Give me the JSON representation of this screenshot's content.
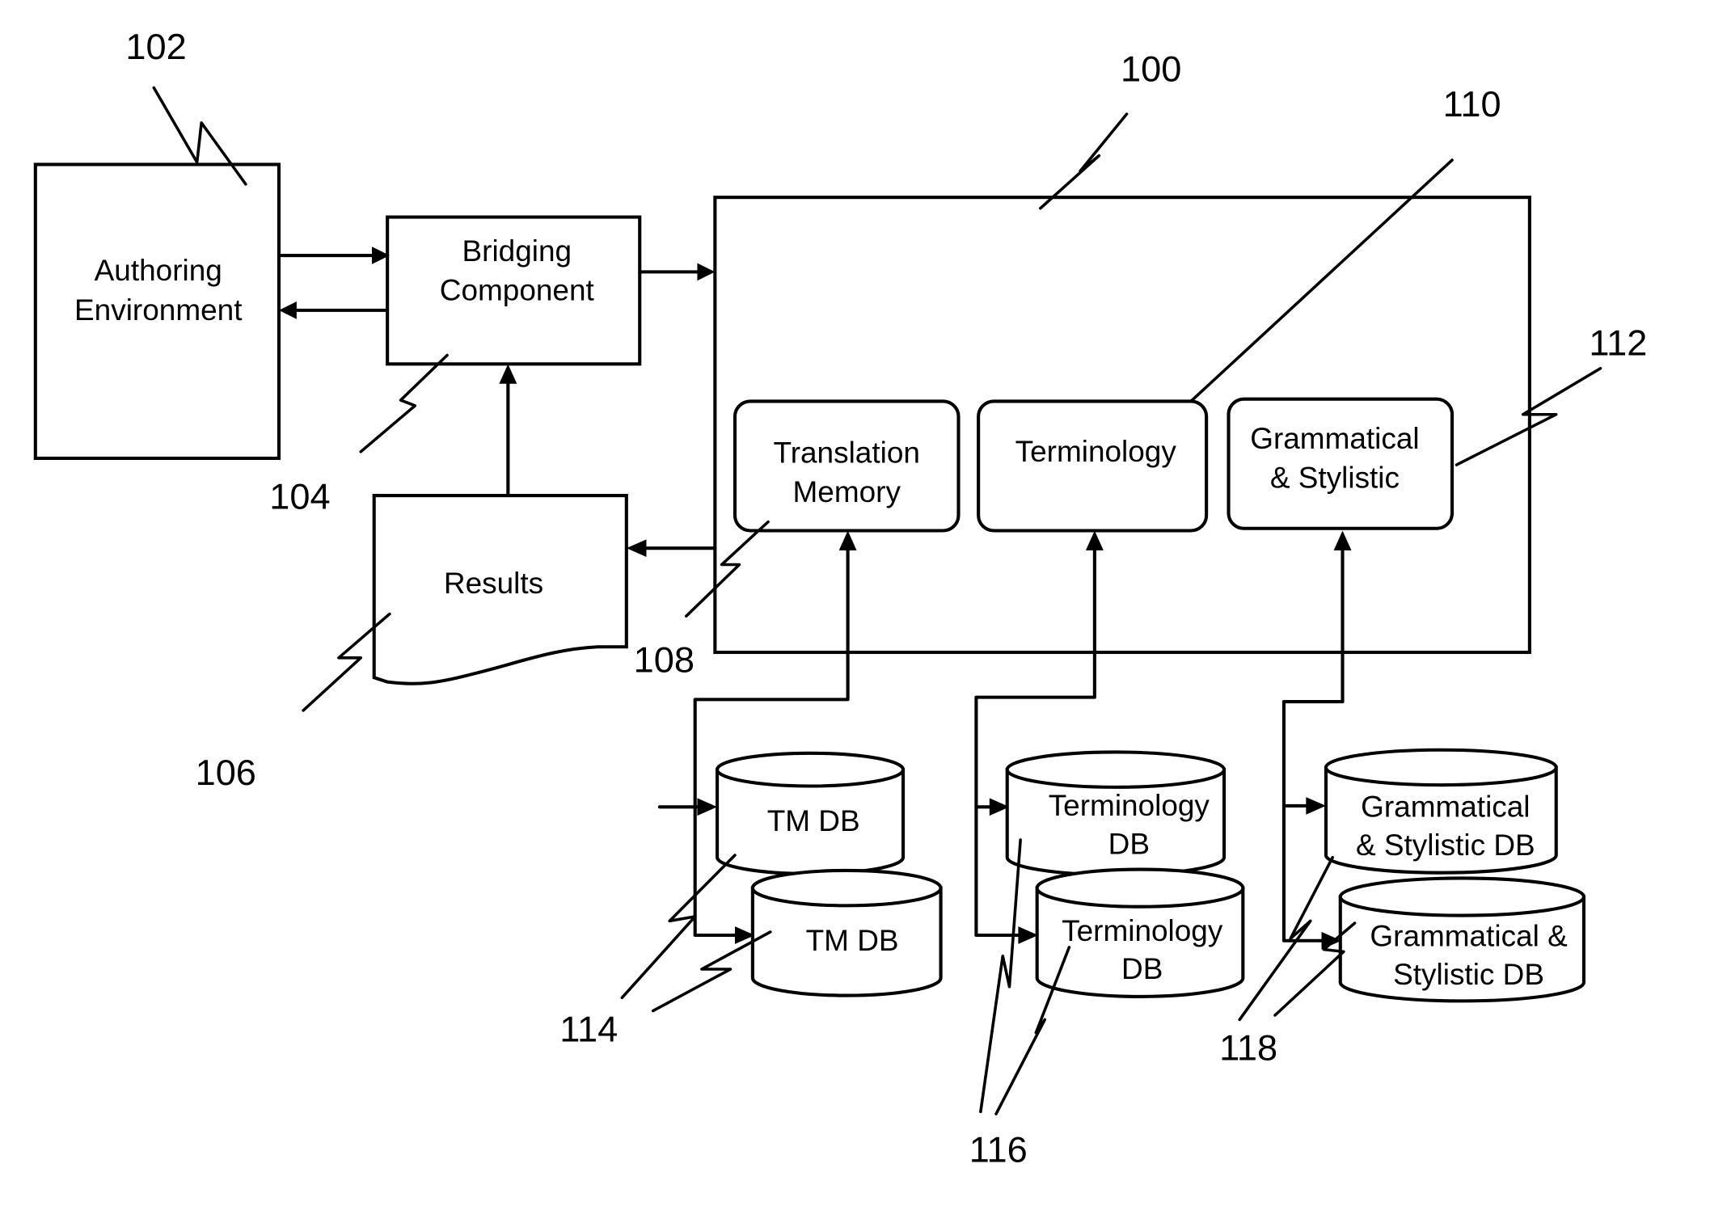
{
  "diagram": {
    "type": "block-diagram",
    "nodes": {
      "authoring": {
        "ref": "102",
        "lines": [
          "Authoring",
          "Environment"
        ]
      },
      "bridging": {
        "ref": "104",
        "lines": [
          "Bridging",
          "Component"
        ]
      },
      "results": {
        "ref": "106",
        "lines": [
          "Results"
        ]
      },
      "system": {
        "ref": "100"
      },
      "translation_memory": {
        "ref": "108",
        "lines": [
          "Translation",
          "Memory"
        ]
      },
      "terminology": {
        "ref": "110",
        "lines": [
          "Terminology"
        ]
      },
      "grammatical": {
        "ref": "112",
        "lines": [
          "Grammatical",
          "& Stylistic"
        ]
      },
      "tm_db_1": {
        "ref": "114",
        "lines": [
          "TM DB"
        ]
      },
      "tm_db_2": {
        "ref": "114",
        "lines": [
          "TM DB"
        ]
      },
      "term_db_1": {
        "ref": "116",
        "lines": [
          "Terminology",
          "DB"
        ]
      },
      "term_db_2": {
        "ref": "116",
        "lines": [
          "Terminology",
          "DB"
        ]
      },
      "gs_db_1": {
        "ref": "118",
        "lines": [
          "Grammatical",
          "& Stylistic DB"
        ]
      },
      "gs_db_2": {
        "ref": "118",
        "lines": [
          "Grammatical &",
          "Stylistic DB"
        ]
      }
    },
    "edges": [
      {
        "from": "authoring",
        "to": "bridging"
      },
      {
        "from": "bridging",
        "to": "authoring"
      },
      {
        "from": "bridging",
        "to": "system"
      },
      {
        "from": "results",
        "to": "bridging"
      },
      {
        "from": "system",
        "to": "results"
      },
      {
        "from": "tm_db_1",
        "to": "translation_memory"
      },
      {
        "from": "tm_db_2",
        "to": "translation_memory"
      },
      {
        "from": "term_db_1",
        "to": "terminology"
      },
      {
        "from": "term_db_2",
        "to": "terminology"
      },
      {
        "from": "gs_db_1",
        "to": "grammatical"
      },
      {
        "from": "gs_db_2",
        "to": "grammatical"
      }
    ],
    "reference_labels": [
      "100",
      "102",
      "104",
      "106",
      "108",
      "110",
      "112",
      "114",
      "116",
      "118"
    ]
  }
}
